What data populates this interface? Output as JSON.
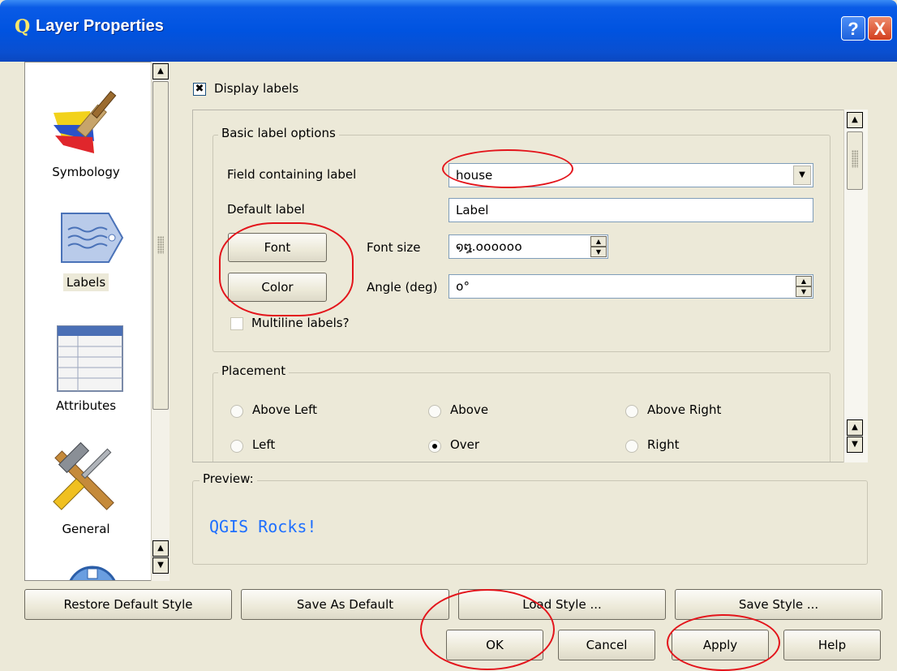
{
  "window": {
    "title": "Layer Properties",
    "help_glyph": "?",
    "close_glyph": "X",
    "app_glyph": "Q"
  },
  "sidebar": {
    "items": [
      {
        "label": "Symbology",
        "icon": "paintbrush-icon",
        "selected": false
      },
      {
        "label": "Labels",
        "icon": "label-tag-icon",
        "selected": true
      },
      {
        "label": "Attributes",
        "icon": "table-icon",
        "selected": false
      },
      {
        "label": "General",
        "icon": "hammer-screwdriver-icon",
        "selected": false
      },
      {
        "label": "",
        "icon": "metadata-icon",
        "selected": false
      }
    ]
  },
  "labels": {
    "display_labels": "Display labels",
    "display_labels_checked": true,
    "basic_group_title": "Basic label options",
    "field_label": "Field containing label",
    "field_value": "house",
    "default_label_label": "Default label",
    "default_label_value": "Label",
    "font_button": "Font",
    "color_button": "Color",
    "font_size_label": "Font size",
    "font_size_value": "໑໘.໐໐໐໐໐໐",
    "angle_label": "Angle (deg)",
    "angle_value": "໐°",
    "multiline_label": "Multiline labels?",
    "multiline_checked": false,
    "placement_group_title": "Placement",
    "placement_options": [
      {
        "label": "Above Left",
        "selected": false
      },
      {
        "label": "Above",
        "selected": false
      },
      {
        "label": "Above Right",
        "selected": false
      },
      {
        "label": "Left",
        "selected": false
      },
      {
        "label": "Over",
        "selected": true
      },
      {
        "label": "Right",
        "selected": false
      }
    ],
    "preview_title": "Preview:",
    "preview_text": "QGIS Rocks!",
    "preview_color": "#1e6fff"
  },
  "buttons": {
    "restore_default": "Restore Default Style",
    "save_as_default": "Save As Default",
    "load_style": "Load Style ...",
    "save_style": "Save Style ...",
    "ok": "OK",
    "cancel": "Cancel",
    "apply": "Apply",
    "help": "Help"
  },
  "annotations": {
    "highlight_color": "#e3141b"
  }
}
